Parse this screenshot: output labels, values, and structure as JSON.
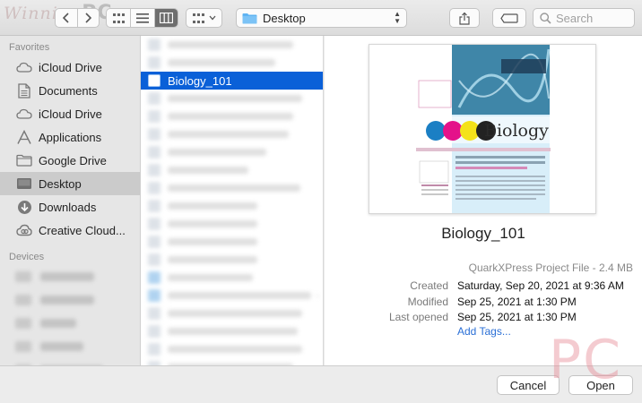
{
  "watermark": {
    "brand": "Winning",
    "pc": "PC"
  },
  "toolbar": {
    "location": "Desktop",
    "search_placeholder": "Search"
  },
  "sidebar": {
    "favorites_label": "Favorites",
    "favorites": [
      {
        "label": "iCloud Drive",
        "icon": "cloud-icon"
      },
      {
        "label": "Documents",
        "icon": "document-icon"
      },
      {
        "label": "iCloud Drive",
        "icon": "cloud-icon"
      },
      {
        "label": "Applications",
        "icon": "applications-icon"
      },
      {
        "label": "Google Drive",
        "icon": "folder-icon"
      },
      {
        "label": "Desktop",
        "icon": "desktop-icon",
        "selected": true
      },
      {
        "label": "Downloads",
        "icon": "download-icon"
      },
      {
        "label": "Creative Cloud...",
        "icon": "creative-cloud-icon"
      }
    ],
    "devices_label": "Devices"
  },
  "files": {
    "selected": "Biology_101"
  },
  "preview": {
    "doc_title": "Biology",
    "name": "Biology_101",
    "kind": "QuarkXPress Project File - 2.4 MB",
    "created_label": "Created",
    "created": "Saturday, Sep 20, 2021 at 9:36 AM",
    "modified_label": "Modified",
    "modified": "Sep 25, 2021 at 1:30 PM",
    "opened_label": "Last opened",
    "opened": "Sep 25, 2021 at 1:30 PM",
    "add_tags": "Add Tags..."
  },
  "buttons": {
    "cancel": "Cancel",
    "open": "Open"
  },
  "colors": {
    "accent": "#0a60d8",
    "link": "#2a6fd6"
  }
}
